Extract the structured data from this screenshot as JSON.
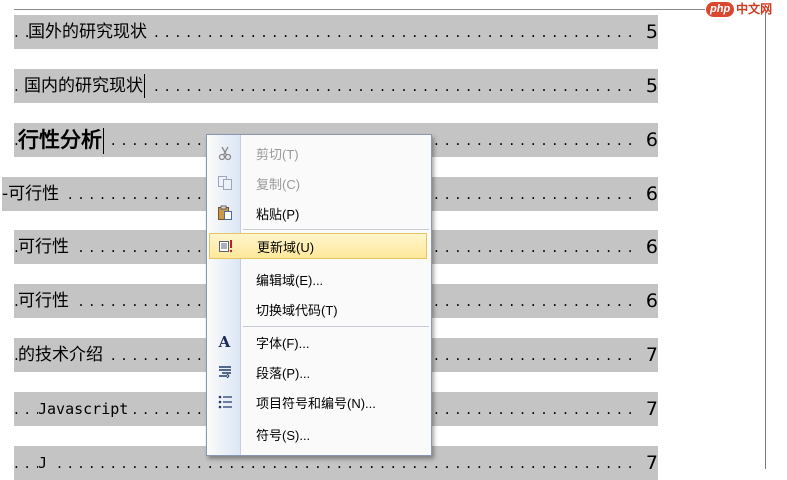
{
  "watermark": {
    "badge": "php",
    "site": "中文网"
  },
  "toc": [
    {
      "text": "国外的研究现状",
      "page": "5",
      "style": "normal"
    },
    {
      "text": "国内的研究现状",
      "page": "5",
      "style": "normal"
    },
    {
      "text": "行性分析",
      "page": "6",
      "style": "bold"
    },
    {
      "text": "-可行性",
      "page": "6",
      "style": "normal"
    },
    {
      "text": "可行性",
      "page": "6",
      "style": "normal"
    },
    {
      "text": "可行性",
      "page": "6",
      "style": "normal"
    },
    {
      "text": "的技术介绍",
      "page": "7",
      "style": "normal"
    },
    {
      "text": "Javascript",
      "page": "7",
      "style": "mono"
    },
    {
      "text": "J",
      "page": "7",
      "style": "mono"
    }
  ],
  "context_menu": {
    "items": [
      {
        "label": "剪切(T)",
        "icon": "scissors-icon",
        "enabled": false
      },
      {
        "label": "复制(C)",
        "icon": "copy-icon",
        "enabled": false
      },
      {
        "label": "粘贴(P)",
        "icon": "paste-icon",
        "enabled": true
      },
      {
        "label": "更新域(U)",
        "icon": "update-field-icon",
        "enabled": true,
        "highlighted": true
      },
      {
        "label": "编辑域(E)...",
        "icon": "",
        "enabled": true
      },
      {
        "label": "切换域代码(T)",
        "icon": "",
        "enabled": true
      },
      {
        "label": "字体(F)...",
        "icon": "font-icon",
        "enabled": true
      },
      {
        "label": "段落(P)...",
        "icon": "paragraph-icon",
        "enabled": true
      },
      {
        "label": "项目符号和编号(N)...",
        "icon": "bullets-icon",
        "enabled": true
      },
      {
        "label": "符号(S)...",
        "icon": "",
        "enabled": true
      }
    ]
  },
  "colors": {
    "toc_shading": "#c4c4c4",
    "menu_highlight": "#ffe89a",
    "menu_border": "#8a97b3"
  }
}
